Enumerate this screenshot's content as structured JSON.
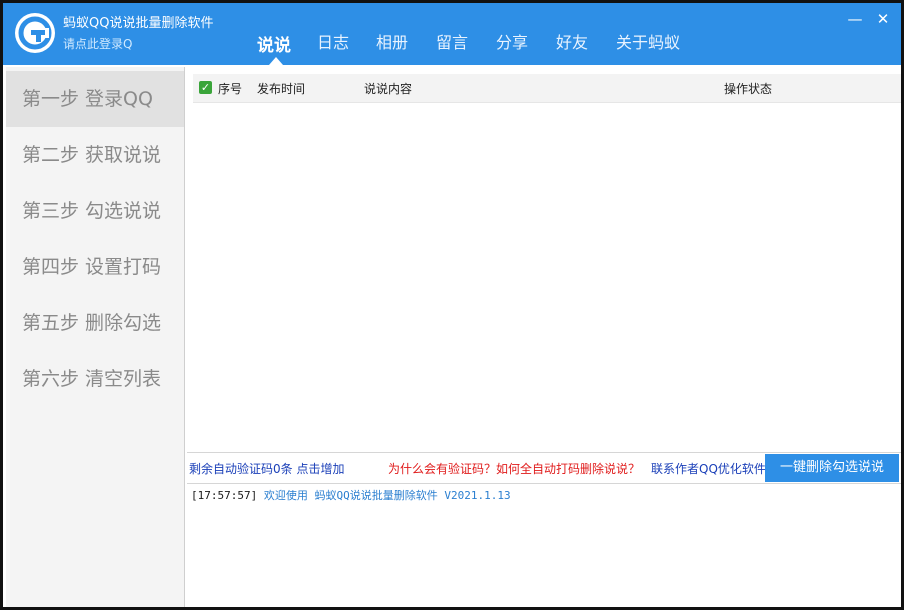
{
  "app": {
    "title": "蚂蚁QQ说说批量删除软件",
    "login_link": "请点此登录Q",
    "accent_color": "#2e8fe6",
    "logo_icon": "ant-g-logo"
  },
  "tabs": [
    {
      "label": "说说",
      "active": true
    },
    {
      "label": "日志",
      "active": false
    },
    {
      "label": "相册",
      "active": false
    },
    {
      "label": "留言",
      "active": false
    },
    {
      "label": "分享",
      "active": false
    },
    {
      "label": "好友",
      "active": false
    },
    {
      "label": "关于蚂蚁",
      "active": false
    }
  ],
  "window_controls": {
    "minimize": "—",
    "close": "✕"
  },
  "steps": [
    {
      "label": "第一步 登录QQ",
      "active": true
    },
    {
      "label": "第二步 获取说说",
      "active": false
    },
    {
      "label": "第三步 勾选说说",
      "active": false
    },
    {
      "label": "第四步 设置打码",
      "active": false
    },
    {
      "label": "第五步 删除勾选",
      "active": false
    },
    {
      "label": "第六步 清空列表",
      "active": false
    }
  ],
  "table": {
    "select_all_checked": true,
    "columns": [
      "序号",
      "发布时间",
      "说说内容",
      "操作状态"
    ],
    "rows": []
  },
  "bottom_bar": {
    "captcha_remaining": "剩余自动验证码0条 点击增加",
    "captcha_help": "为什么会有验证码？如何全自动打码删除说说？",
    "contact": "联系作者QQ优化软件",
    "delete_button": "一键删除勾选说说"
  },
  "log": [
    {
      "time": "[17:57:57]",
      "message": "欢迎使用 蚂蚁QQ说说批量删除软件 V2021.1.13"
    }
  ]
}
